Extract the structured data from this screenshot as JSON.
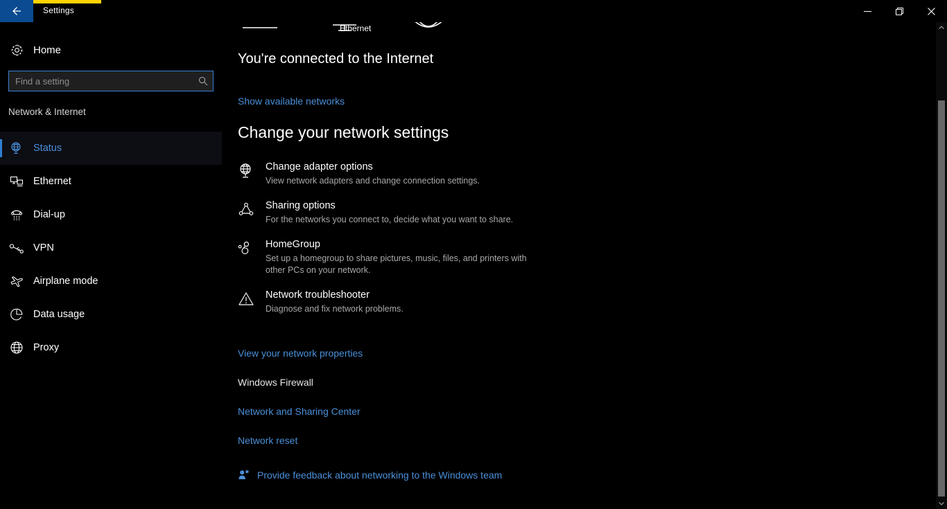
{
  "window": {
    "title": "Settings",
    "back_icon": "back-arrow-icon",
    "accent_color": "#ffd400",
    "controls": {
      "minimize": "minimize-icon",
      "restore": "restore-icon",
      "close": "close-icon"
    }
  },
  "sidebar": {
    "home": {
      "label": "Home",
      "icon": "gear-icon"
    },
    "search": {
      "placeholder": "Find a setting",
      "value": "",
      "icon": "search-icon"
    },
    "category_title": "Network & Internet",
    "items": [
      {
        "label": "Status",
        "icon": "network-status-icon",
        "selected": true
      },
      {
        "label": "Ethernet",
        "icon": "ethernet-icon",
        "selected": false
      },
      {
        "label": "Dial-up",
        "icon": "dialup-phone-icon",
        "selected": false
      },
      {
        "label": "VPN",
        "icon": "vpn-key-icon",
        "selected": false
      },
      {
        "label": "Airplane mode",
        "icon": "airplane-icon",
        "selected": false
      },
      {
        "label": "Data usage",
        "icon": "pie-chart-icon",
        "selected": false
      },
      {
        "label": "Proxy",
        "icon": "globe-icon",
        "selected": false
      }
    ],
    "selected_color": "#4a90d9"
  },
  "main": {
    "network_diagram": {
      "label": "Ethernet",
      "icon": "network-connection-diagram"
    },
    "status_heading": "You're connected to the Internet",
    "show_networks_link": "Show available networks",
    "section_heading": "Change your network settings",
    "settings": [
      {
        "title": "Change adapter options",
        "description": "View network adapters and change connection settings.",
        "icon": "network-adapter-icon"
      },
      {
        "title": "Sharing options",
        "description": "For the networks you connect to, decide what you want to share.",
        "icon": "sharing-icon"
      },
      {
        "title": "HomeGroup",
        "description": "Set up a homegroup to share pictures, music, files, and printers with other PCs on your network.",
        "icon": "homegroup-icon"
      },
      {
        "title": "Network troubleshooter",
        "description": "Diagnose and fix network problems.",
        "icon": "warning-triangle-icon"
      }
    ],
    "links": [
      {
        "label": "View your network properties",
        "style": "link"
      },
      {
        "label": "Windows Firewall",
        "style": "plain"
      },
      {
        "label": "Network and Sharing Center",
        "style": "link"
      },
      {
        "label": "Network reset",
        "style": "link"
      }
    ],
    "feedback": {
      "label": "Provide feedback about networking to the Windows team",
      "icon": "feedback-person-icon"
    },
    "link_color": "#4a90d9"
  },
  "scrollbar": {
    "up_icon": "chevron-up-icon",
    "down_icon": "chevron-down-icon",
    "thumb": "scroll-thumb"
  }
}
